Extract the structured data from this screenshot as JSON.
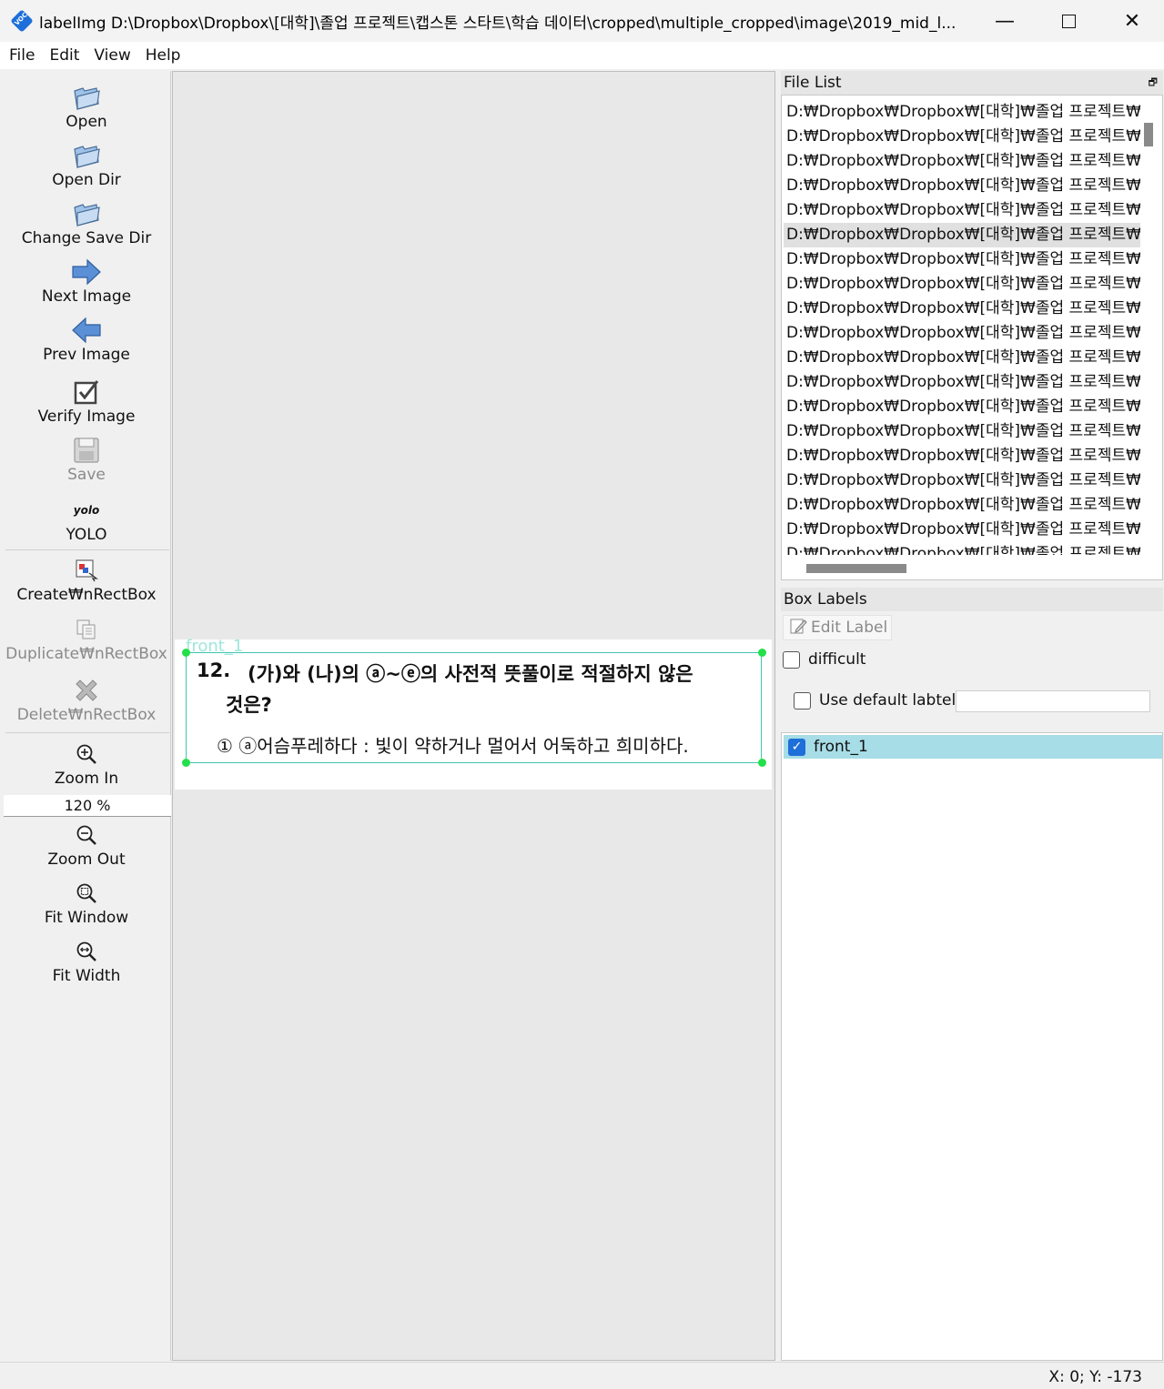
{
  "window": {
    "title": "labelImg D:\\Dropbox\\Dropbox\\[대학]\\졸업 프로젝트\\캡스톤 스타트\\학습 데이터\\cropped\\multiple_cropped\\image\\2019_mid_l...",
    "app_icon_text": "VOC",
    "minimize": "—",
    "close": "✕"
  },
  "menu": [
    "File",
    "Edit",
    "View",
    "Help"
  ],
  "toolbar": {
    "open": "Open",
    "open_dir": "Open Dir",
    "change_save_dir": "Change Save Dir",
    "next_image": "Next Image",
    "prev_image": "Prev Image",
    "verify_image": "Verify Image",
    "save": "Save",
    "yolo_icon_text": "yolo",
    "yolo": "YOLO",
    "create_rect": "Create₩nRectBox",
    "duplicate_rect": "Duplicate₩nRectBox",
    "delete_rect": "Delete₩nRectBox",
    "zoom_in": "Zoom In",
    "zoom_value": "120 %",
    "zoom_out": "Zoom Out",
    "fit_window": "Fit Window",
    "fit_width": "Fit Width"
  },
  "canvas": {
    "bbox_label": "front_1",
    "doc_number": "12.",
    "doc_line1": "(가)와 (나)의 ⓐ~ⓔ의 사전적 뜻풀이로 적절하지 않은",
    "doc_line2": "것은?",
    "doc_line3": "① ⓐ어슴푸레하다 : 빛이 약하거나 멀어서 어둑하고 희미하다."
  },
  "file_list": {
    "title": "File List",
    "float_icon": "float-icon",
    "items": [
      "D:₩Dropbox₩Dropbox₩[대학]₩졸업 프로젝트₩",
      "D:₩Dropbox₩Dropbox₩[대학]₩졸업 프로젝트₩",
      "D:₩Dropbox₩Dropbox₩[대학]₩졸업 프로젝트₩",
      "D:₩Dropbox₩Dropbox₩[대학]₩졸업 프로젝트₩",
      "D:₩Dropbox₩Dropbox₩[대학]₩졸업 프로젝트₩",
      "D:₩Dropbox₩Dropbox₩[대학]₩졸업 프로젝트₩",
      "D:₩Dropbox₩Dropbox₩[대학]₩졸업 프로젝트₩",
      "D:₩Dropbox₩Dropbox₩[대학]₩졸업 프로젝트₩",
      "D:₩Dropbox₩Dropbox₩[대학]₩졸업 프로젝트₩",
      "D:₩Dropbox₩Dropbox₩[대학]₩졸업 프로젝트₩",
      "D:₩Dropbox₩Dropbox₩[대학]₩졸업 프로젝트₩",
      "D:₩Dropbox₩Dropbox₩[대학]₩졸업 프로젝트₩",
      "D:₩Dropbox₩Dropbox₩[대학]₩졸업 프로젝트₩",
      "D:₩Dropbox₩Dropbox₩[대학]₩졸업 프로젝트₩",
      "D:₩Dropbox₩Dropbox₩[대학]₩졸업 프로젝트₩",
      "D:₩Dropbox₩Dropbox₩[대학]₩졸업 프로젝트₩",
      "D:₩Dropbox₩Dropbox₩[대학]₩졸업 프로젝트₩",
      "D:₩Dropbox₩Dropbox₩[대학]₩졸업 프로젝트₩",
      "D:₩Dropbox₩Dropbox₩[대학]₩졸업 프로젝트₩"
    ],
    "selected_index": 5
  },
  "box_labels": {
    "title": "Box Labels",
    "edit_label": "Edit Label",
    "difficult": "difficult",
    "use_default_label": "Use default labtel",
    "default_label_value": "",
    "labels": [
      {
        "name": "front_1",
        "checked": true
      }
    ]
  },
  "status": {
    "coords": "X: 0; Y: -173"
  },
  "colors": {
    "bbox_line": "#40c4b0",
    "handle": "#22e04a",
    "label_highlight": "#a7dde6",
    "checkbox_blue": "#1e6fd9"
  }
}
